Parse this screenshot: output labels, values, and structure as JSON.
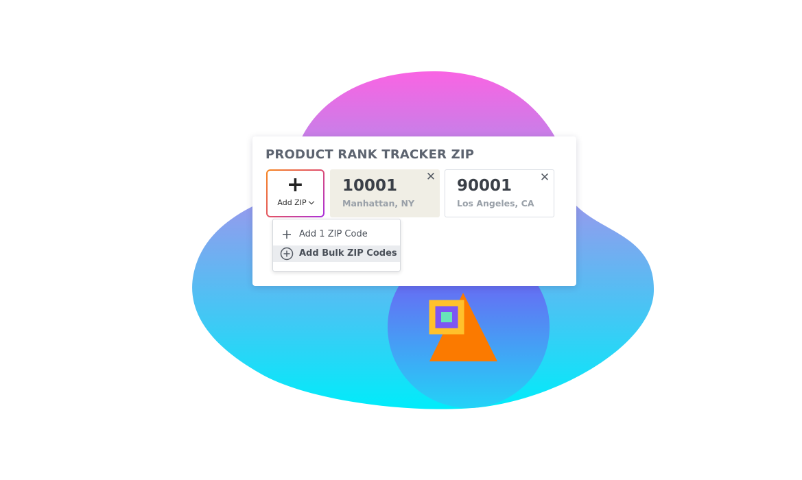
{
  "widget": {
    "title": "PRODUCT RANK TRACKER ZIP",
    "add_button": {
      "icon": "plus-icon",
      "label": "Add ZIP",
      "caret_icon": "chevron-down-icon"
    },
    "zip_cards": [
      {
        "code": "10001",
        "location": "Manhattan, NY",
        "remove_icon": "close-icon",
        "highlighted": true
      },
      {
        "code": "90001",
        "location": "Los Angeles, CA",
        "remove_icon": "close-icon",
        "highlighted": false
      }
    ],
    "dropdown": {
      "items": [
        {
          "label": "Add 1 ZIP Code",
          "icon": "plus-icon",
          "hovered": false
        },
        {
          "label": "Add Bulk ZIP Codes",
          "icon": "plus-circle-icon",
          "hovered": true
        }
      ]
    }
  },
  "colors": {
    "blob_top": "#f964e3",
    "blob_bottom": "#00ecfa",
    "circle_top": "#7b4ef2",
    "circle_bottom": "#23d2f7",
    "triangle": "#fb7a00",
    "square_outline": "#ffc12b",
    "square_fill": "#7c56f3",
    "square_inner": "#67e4b9",
    "add_button_gradient_start": "#f7861b",
    "add_button_gradient_end": "#a92fe0",
    "highlight_card_bg": "#f0eee5",
    "title_text": "#5d6470"
  }
}
